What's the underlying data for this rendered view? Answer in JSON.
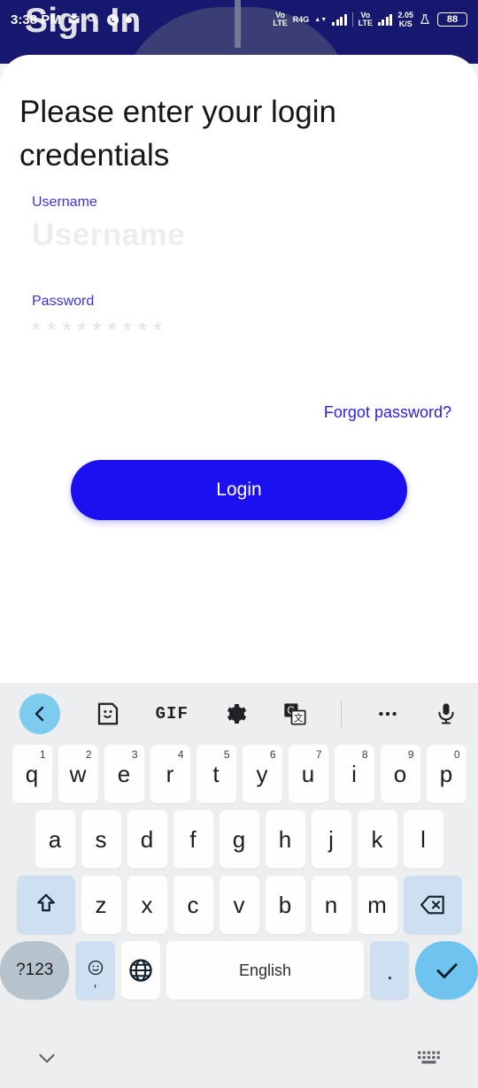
{
  "statusbar": {
    "clock": "3:38 PM",
    "left_icons": [
      "message-icon",
      "key-icon",
      "phone-icon",
      "dot-indicator"
    ],
    "network_1": {
      "line1": "Vo",
      "line2": "LTE",
      "label": "R4G"
    },
    "network_2": {
      "line1": "Vo",
      "line2": "LTE"
    },
    "data_speed": {
      "value": "2.05",
      "unit": "K/S"
    },
    "right_icons": [
      "flask-icon"
    ],
    "battery_level": "88"
  },
  "header": {
    "title": "Sign In"
  },
  "form": {
    "heading": "Please enter your login credentials",
    "username": {
      "label": "Username",
      "placeholder": "Username",
      "value": ""
    },
    "password": {
      "label": "Password",
      "placeholder": "*********",
      "value": ""
    },
    "forgot_password": "Forgot password?",
    "login_button": "Login"
  },
  "colors": {
    "header_bg": "#16176E",
    "accent_blue": "#1A10F0",
    "link_blue": "#2D22DD",
    "label_blue": "#3A34E0",
    "keyboard_bg": "#ECEEF0",
    "key_accent": "#CDDFF0",
    "enter_key": "#6FC3EF"
  },
  "keyboard": {
    "toolbar": [
      {
        "name": "back-chevron-icon",
        "label": ""
      },
      {
        "name": "sticker-icon",
        "label": ""
      },
      {
        "name": "gif-icon",
        "label": "GIF"
      },
      {
        "name": "gear-icon",
        "label": ""
      },
      {
        "name": "google-translate-icon",
        "label": ""
      },
      {
        "name": "more-options-icon",
        "label": ""
      },
      {
        "name": "microphone-icon",
        "label": ""
      }
    ],
    "row1": [
      {
        "key": "q",
        "sup": "1"
      },
      {
        "key": "w",
        "sup": "2"
      },
      {
        "key": "e",
        "sup": "3"
      },
      {
        "key": "r",
        "sup": "4"
      },
      {
        "key": "t",
        "sup": "5"
      },
      {
        "key": "y",
        "sup": "6"
      },
      {
        "key": "u",
        "sup": "7"
      },
      {
        "key": "i",
        "sup": "8"
      },
      {
        "key": "o",
        "sup": "9"
      },
      {
        "key": "p",
        "sup": "0"
      }
    ],
    "row2": [
      "a",
      "s",
      "d",
      "f",
      "g",
      "h",
      "j",
      "k",
      "l"
    ],
    "row3": [
      "z",
      "x",
      "c",
      "v",
      "b",
      "n",
      "m"
    ],
    "shift_key": "shift-icon",
    "backspace_key": "backspace-icon",
    "symbols_key": "?123",
    "emoji_key": "emoji-comma-key",
    "comma_label": ",",
    "globe_key": "globe-icon",
    "space_key": "English",
    "period_key": ".",
    "enter_key": "check-icon"
  },
  "navbar": {
    "hide_keyboard": "chevron-down-icon",
    "switch_keyboard": "keyboard-icon"
  }
}
